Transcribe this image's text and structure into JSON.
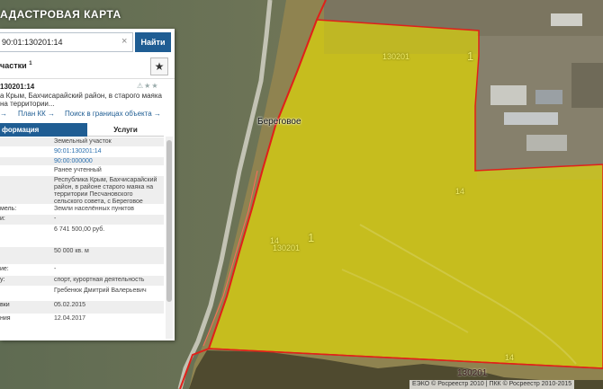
{
  "app": {
    "title": "АДАСТРОВАЯ КАРТА"
  },
  "search": {
    "value": "90:01:130201:14",
    "button_label": "Найти"
  },
  "section": {
    "title": "частки",
    "count": "1",
    "fav_icon": "star-icon"
  },
  "object": {
    "id": "130201:14",
    "address_snippet": "а Крым, Бахчисарайский район, в старого маяка на территории...",
    "links": [
      "→",
      "План КК →",
      "Поиск в границах объекта →"
    ]
  },
  "tabs": {
    "info": "формация",
    "services": "Услуги"
  },
  "attributes": [
    {
      "key": "",
      "value": "Земельный участок",
      "link": false
    },
    {
      "key": "",
      "value": "90:01:130201:14",
      "link": true
    },
    {
      "key": "",
      "value": "90:00:000000",
      "link": true
    },
    {
      "key": "",
      "value": "Ранее учтенный",
      "link": false
    },
    {
      "key": "",
      "value": "Республика Крым, Бахчисарайский район, в районе старого маяка на территории Песчановского сельского совета, с Береговое",
      "link": false
    },
    {
      "key": "мель:",
      "value": "Земли населённых пунктов",
      "link": false
    },
    {
      "key": "и:",
      "value": "-",
      "link": false
    },
    {
      "key": "",
      "value": "6 741 500,00 руб.",
      "link": false
    },
    {
      "key": "",
      "value": "50 000 кв. м",
      "link": false
    },
    {
      "key": "ие:",
      "value": "-",
      "link": false
    },
    {
      "key": "у:",
      "value": "спорт, курортная деятельность",
      "link": false
    },
    {
      "key": "",
      "value": "Гребенюк Дмитрий Валерьевич",
      "link": false
    },
    {
      "key": "вки",
      "value": "05.02.2015",
      "link": false
    },
    {
      "key": "ния",
      "value": "12.04.2017",
      "link": false
    }
  ],
  "map": {
    "place_name": "Береговое",
    "labels": [
      "130201",
      "1",
      "14",
      "14",
      "130201",
      "1",
      "14",
      "130201"
    ],
    "parcel_color": "#e8e000",
    "border_color": "#e0201a"
  },
  "attribution": "ЕЭКО © Росреестр 2010 | ПКК © Росреестр 2010-2015"
}
